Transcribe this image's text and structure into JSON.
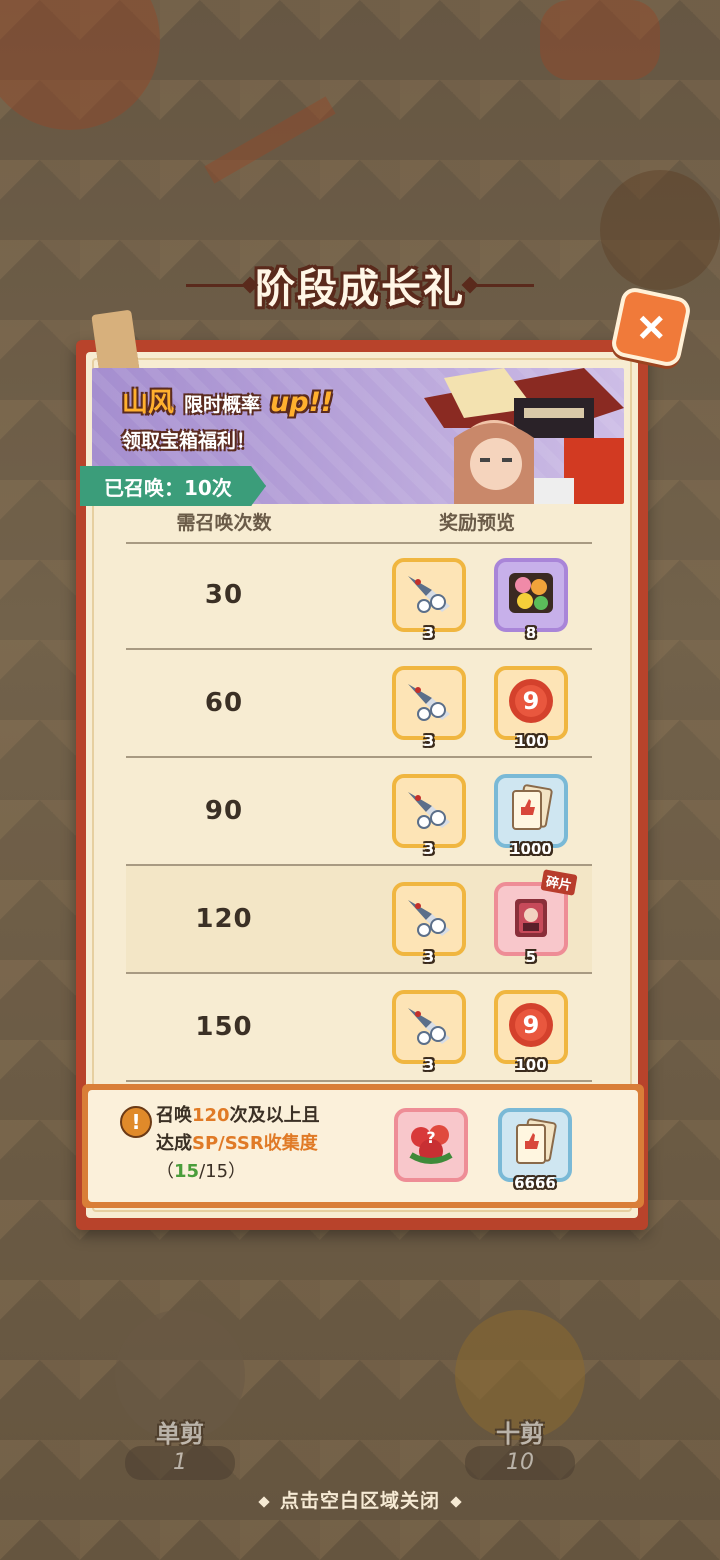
{
  "title": "阶段成长礼",
  "close_icon": "plus-close-icon",
  "banner": {
    "name": "山风",
    "rate_text": "限时概率",
    "up_text": "up!!",
    "subtitle": "领取宝箱福利！"
  },
  "summon_count": "已召唤：10次",
  "table": {
    "col_count": "需召唤次数",
    "col_reward": "奖励预览",
    "rows": [
      {
        "count": "30",
        "items": [
          {
            "icon": "scissors-icon",
            "qty": "3",
            "style": "orange"
          },
          {
            "icon": "flower-bouquet-icon",
            "qty": "8",
            "style": "purple"
          }
        ]
      },
      {
        "count": "60",
        "items": [
          {
            "icon": "scissors-icon",
            "qty": "3",
            "style": "orange"
          },
          {
            "icon": "red-nine-token-icon",
            "qty": "100",
            "style": "orange"
          }
        ]
      },
      {
        "count": "90",
        "items": [
          {
            "icon": "scissors-icon",
            "qty": "3",
            "style": "orange"
          },
          {
            "icon": "like-card-icon",
            "qty": "1000",
            "style": "blue"
          }
        ]
      },
      {
        "count": "120",
        "items": [
          {
            "icon": "scissors-icon",
            "qty": "3",
            "style": "orange"
          },
          {
            "icon": "fragment-card-icon",
            "qty": "5",
            "style": "pink",
            "tag": "碎片"
          }
        ]
      },
      {
        "count": "150",
        "items": [
          {
            "icon": "scissors-icon",
            "qty": "3",
            "style": "orange"
          },
          {
            "icon": "red-nine-token-icon",
            "qty": "100",
            "style": "orange"
          }
        ]
      }
    ]
  },
  "bonus": {
    "line1_a": "召唤",
    "line1_num": "120",
    "line1_b": "次及以上且",
    "line2_a": "达成",
    "line2_hl": "SP/SSR收集度",
    "line3_open": "（",
    "line3_cur": "15",
    "line3_rest": "/15）",
    "items": [
      {
        "icon": "mystery-flower-icon",
        "qty": "",
        "style": "pink"
      },
      {
        "icon": "like-card-icon",
        "qty": "6666",
        "style": "blue"
      }
    ]
  },
  "summon_single": {
    "label": "单剪",
    "num": "1"
  },
  "summon_ten": {
    "label": "十剪",
    "num": "10"
  },
  "close_hint": "点击空白区域关闭"
}
